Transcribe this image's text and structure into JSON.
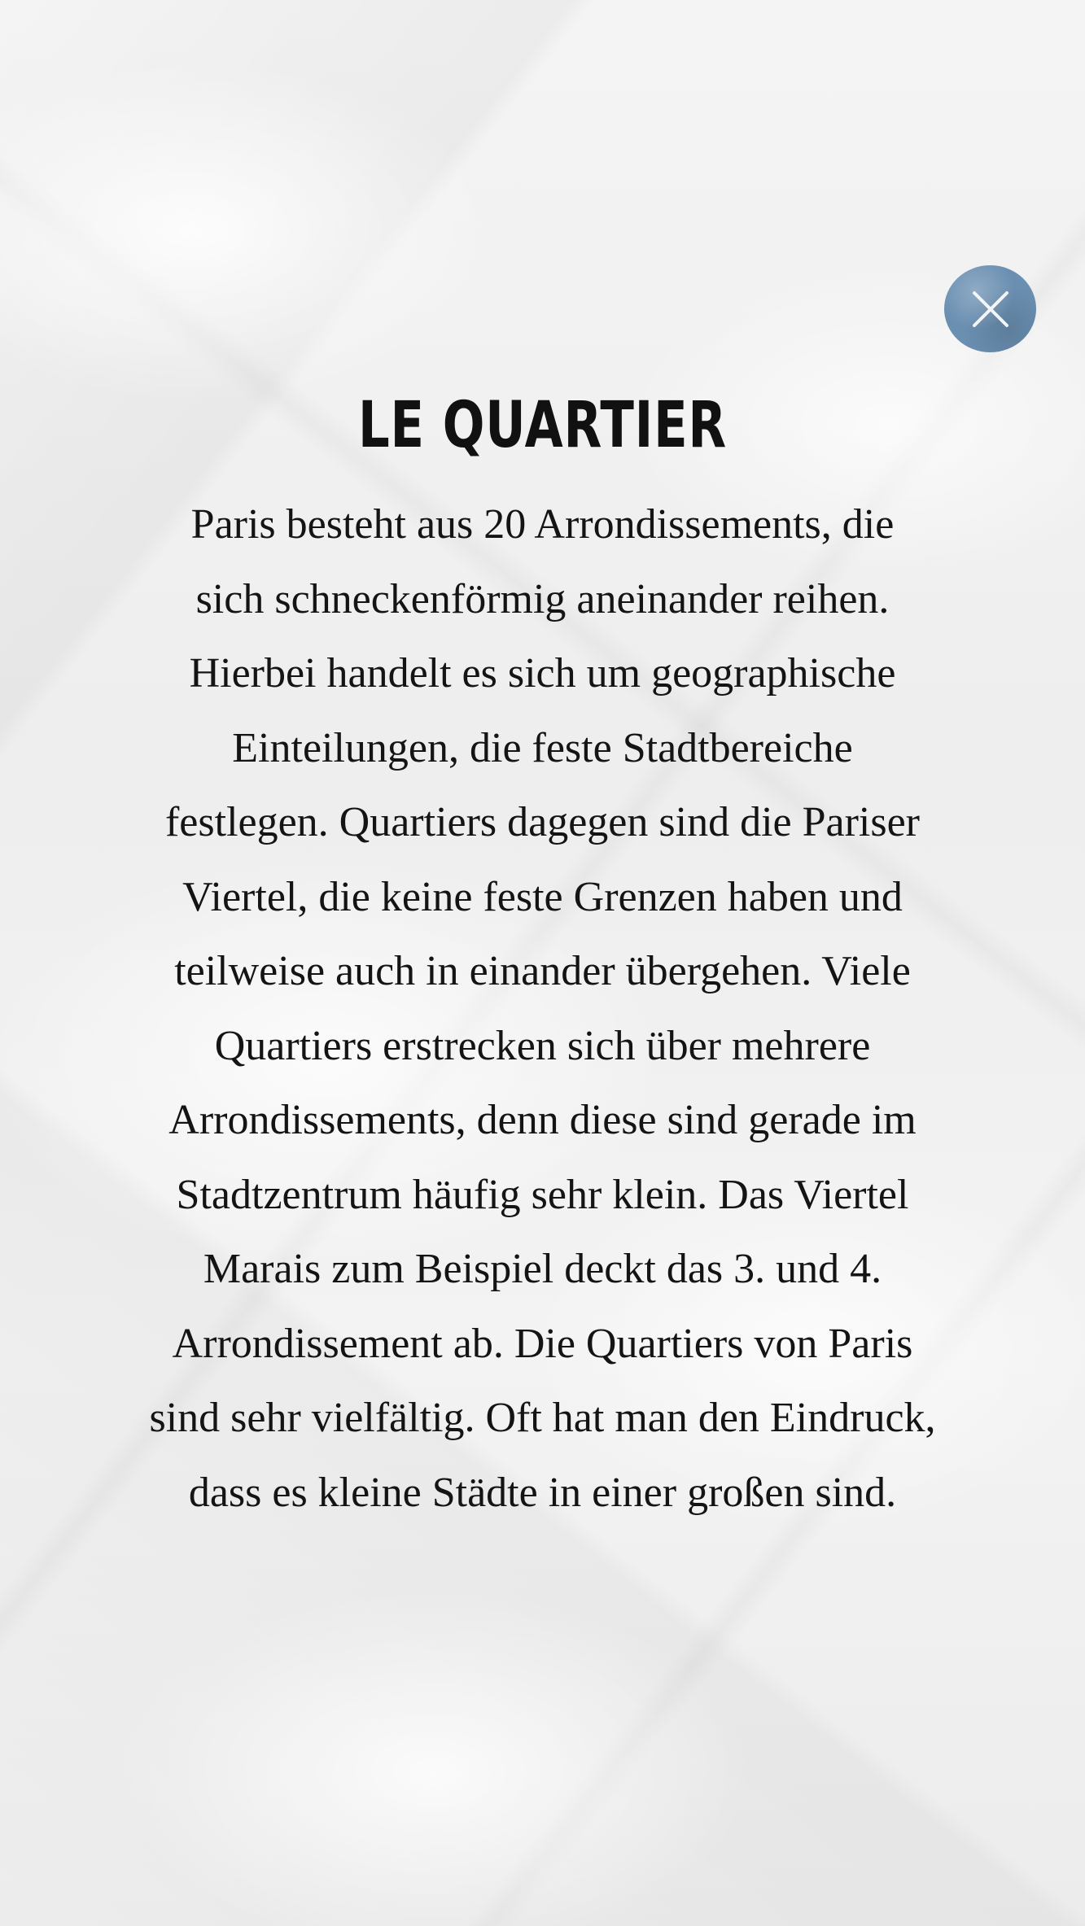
{
  "overlay": {
    "close_icon": "close-icon",
    "accent_color": "#6a8fb1"
  },
  "content": {
    "title": "LE QUARTIER",
    "body_lines": [
      "Paris besteht aus 20 Arrondissements, die",
      "sich schneckenförmig aneinander reihen.",
      "Hierbei handelt es sich um geographische",
      "Einteilungen, die feste Stadtbereiche",
      "festlegen. Quartiers dagegen sind die Pariser",
      "Viertel, die keine feste Grenzen haben und",
      "teilweise auch in einander übergehen. Viele",
      "Quartiers erstrecken sich über mehrere",
      "Arrondissements, denn diese sind gerade im",
      "Stadtzentrum häufig sehr klein. Das Viertel",
      "Marais zum Beispiel deckt das 3. und 4.",
      "Arrondissement ab. Die Quartiers von Paris",
      "sind sehr vielfältig. Oft hat man den Eindruck,",
      "dass es kleine Städte in einer großen sind."
    ]
  }
}
